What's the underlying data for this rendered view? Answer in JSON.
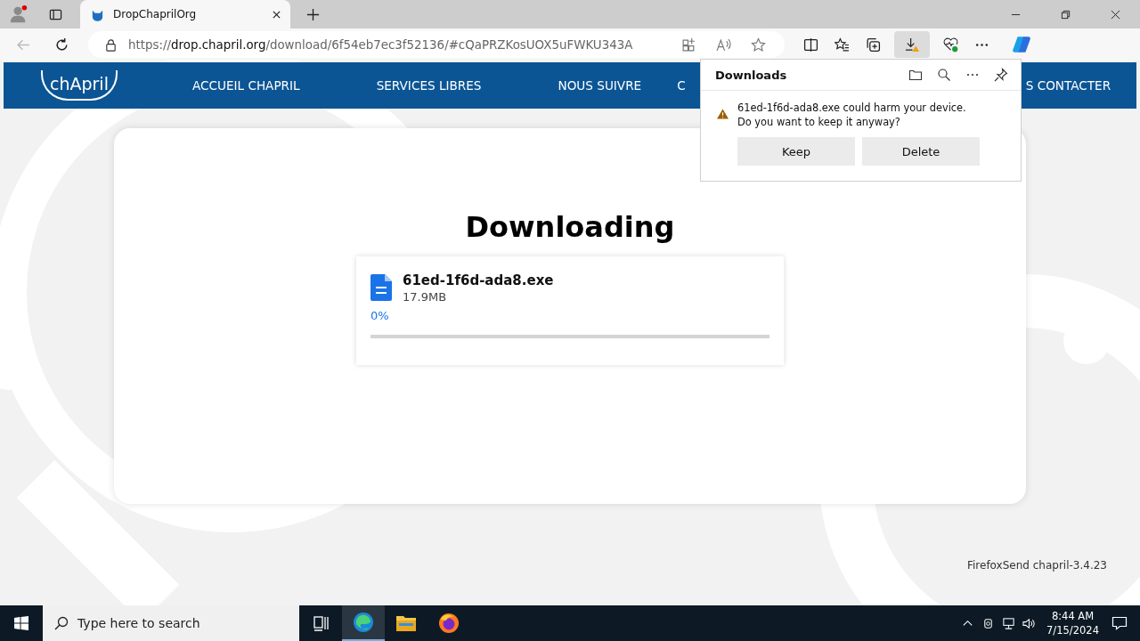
{
  "browser": {
    "tab": {
      "title": "DropChaprilOrg",
      "selected": true
    },
    "address": {
      "scheme": "https://",
      "domain": "drop.chapril.org",
      "path": "/download/6f54eb7ec3f52136/#cQaPRZKosUOX5uFWKU343A"
    }
  },
  "site": {
    "logo": "chApril",
    "nav": [
      {
        "label": "ACCUEIL CHAPRIL"
      },
      {
        "label": "SERVICES LIBRES"
      },
      {
        "label": "NOUS SUIVRE"
      },
      {
        "label": "C"
      },
      {
        "label": "S CONTACTER"
      }
    ]
  },
  "download_card": {
    "title": "Downloading",
    "file": {
      "name": "61ed-1f6d-ada8.exe",
      "size": "17.9MB"
    },
    "percent": "0%",
    "level": 0
  },
  "footer": "FirefoxSend chapril-3.4.23",
  "downloads_panel": {
    "title": "Downloads",
    "warning": "61ed-1f6d-ada8.exe could harm your device. Do you want to keep it anyway?",
    "buttons": [
      "Keep",
      "Delete"
    ]
  },
  "taskbar": {
    "search_placeholder": "Type here to search",
    "clock": {
      "time": "8:44 AM",
      "date": "7/15/2024"
    }
  }
}
